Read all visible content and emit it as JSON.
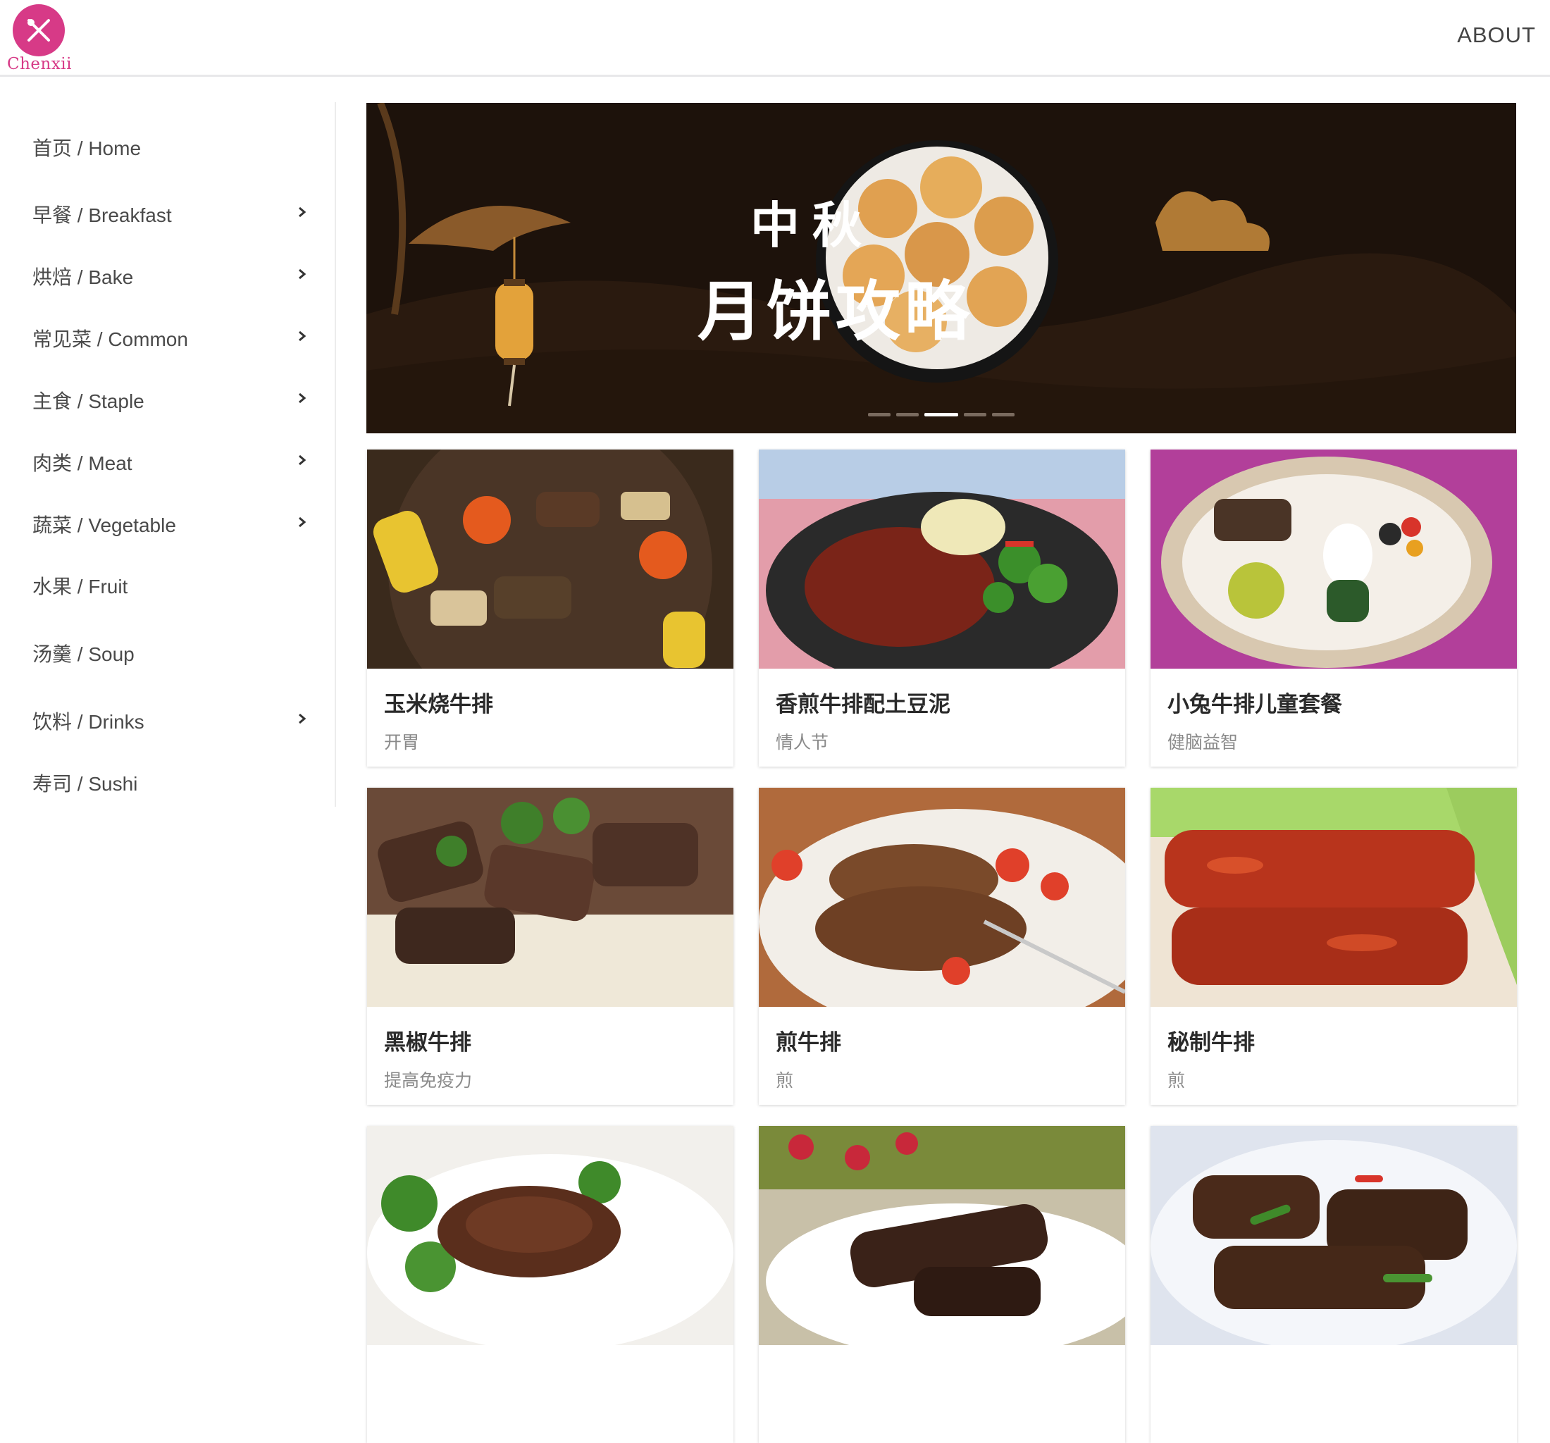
{
  "header": {
    "logo_text": "Chenxii",
    "about_label": "ABOUT"
  },
  "sidebar": {
    "items": [
      {
        "label": "首页 / Home",
        "has_submenu": false
      },
      {
        "label": "早餐 / Breakfast",
        "has_submenu": true
      },
      {
        "label": "烘焙 / Bake",
        "has_submenu": true
      },
      {
        "label": "常见菜 / Common",
        "has_submenu": true
      },
      {
        "label": "主食 / Staple",
        "has_submenu": true
      },
      {
        "label": "肉类 / Meat",
        "has_submenu": true
      },
      {
        "label": "蔬菜 / Vegetable",
        "has_submenu": true
      },
      {
        "label": "水果 / Fruit",
        "has_submenu": false
      },
      {
        "label": "汤羹 / Soup",
        "has_submenu": false
      },
      {
        "label": "饮料 / Drinks",
        "has_submenu": true
      },
      {
        "label": "寿司 / Sushi",
        "has_submenu": false
      }
    ]
  },
  "banner": {
    "line1": "中秋",
    "line2": "月饼攻略",
    "slide_count": 5,
    "active_slide": 3
  },
  "recipes": [
    {
      "title": "玉米烧牛排",
      "tag": "开胃"
    },
    {
      "title": "香煎牛排配土豆泥",
      "tag": "情人节"
    },
    {
      "title": "小兔牛排儿童套餐",
      "tag": "健脑益智"
    },
    {
      "title": "黑椒牛排",
      "tag": "提高免疫力"
    },
    {
      "title": "煎牛排",
      "tag": "煎"
    },
    {
      "title": "秘制牛排",
      "tag": "煎"
    },
    {
      "title": "",
      "tag": ""
    },
    {
      "title": "",
      "tag": ""
    },
    {
      "title": "",
      "tag": ""
    }
  ],
  "colors": {
    "brand": "#d73a87",
    "banner_bg": "#1d120b",
    "sidebar_text": "#4a4a4a",
    "card_title": "#2a2a2a",
    "card_tag": "#8a8a8a"
  },
  "icons": {
    "logo": "fork-knife-icon",
    "submenu": "chevron-right-icon"
  }
}
